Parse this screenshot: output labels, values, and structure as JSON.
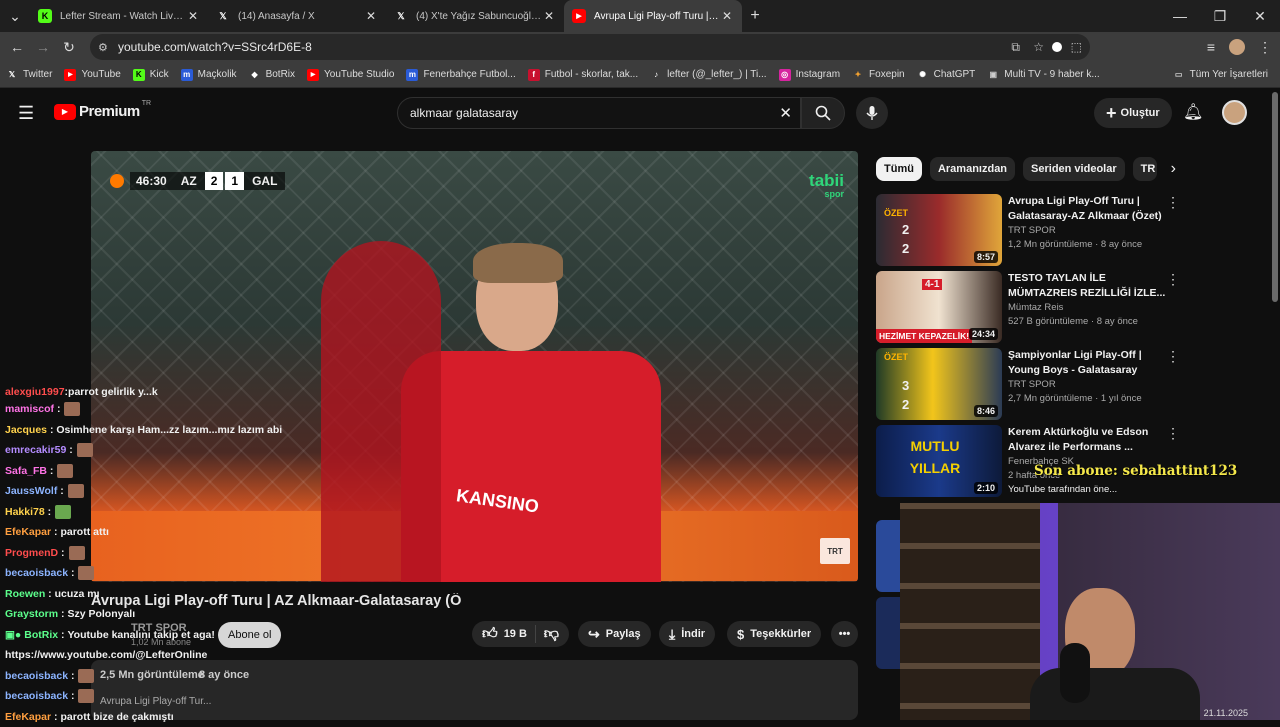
{
  "browser": {
    "tabs": [
      {
        "label": "Lefter Stream - Watch Live on Kick",
        "favicon": "kick-icon",
        "color": "#53fc18"
      },
      {
        "label": "(14) Anasayfa / X",
        "favicon": "x-icon",
        "color": "#000000"
      },
      {
        "label": "(4) X'te Yağız Sabuncuoğlu: \"Öz...",
        "favicon": "x-icon",
        "color": "#000000"
      },
      {
        "label": "Avrupa Ligi Play-off Turu | AZ A...",
        "favicon": "youtube-icon",
        "color": "#ff0000"
      }
    ],
    "url": "youtube.com/watch?v=SSrc4rD6E-8",
    "bookmarks": [
      {
        "label": "Twitter",
        "icon": "x-icon"
      },
      {
        "label": "YouTube",
        "icon": "youtube-icon"
      },
      {
        "label": "Kick",
        "icon": "kick-icon"
      },
      {
        "label": "Maçkolik",
        "icon": "mackolik-icon"
      },
      {
        "label": "BotRix",
        "icon": "botrix-icon"
      },
      {
        "label": "YouTube Studio",
        "icon": "youtube-icon"
      },
      {
        "label": "Fenerbahçe Futbol...",
        "icon": "m-icon"
      },
      {
        "label": "Futbol - skorlar, tak...",
        "icon": "flashscore-icon"
      },
      {
        "label": "lefter (@_lefter_) | Ti...",
        "icon": "tiktok-icon"
      },
      {
        "label": "Instagram",
        "icon": "instagram-icon"
      },
      {
        "label": "Foxepin",
        "icon": "foxepin-icon"
      },
      {
        "label": "ChatGPT",
        "icon": "chatgpt-icon"
      },
      {
        "label": "Multi TV - 9 haber k...",
        "icon": "tv-icon"
      }
    ],
    "all_bookmarks": "Tüm Yer İşaretleri"
  },
  "youtube": {
    "logo": "Premium",
    "region": "TR",
    "search_value": "alkmaar galatasaray",
    "create_label": "Oluştur"
  },
  "player": {
    "scorebug": {
      "time": "46:30",
      "home": "AZ",
      "home_score": "2",
      "away_score": "1",
      "away": "GAL"
    },
    "channel_logo": "tabii",
    "channel_logo_sub": "spor",
    "watermark": "TRT SPOR",
    "jersey_text": "KANSINO"
  },
  "video": {
    "title": "Avrupa Ligi Play-off Turu | AZ Alkmaar-Galatasaray (Ö",
    "channel": "TRT SPOR",
    "subscribers": "1,02 Mn abone",
    "subscribe_label": "Abone ol",
    "likes": "19 B",
    "share_label": "Paylaş",
    "download_label": "İndir",
    "thanks_label": "Teşekkürler",
    "views": "2,5 Mn görüntüleme",
    "age": "8 ay önce",
    "desc_snippet": "Avrupa Ligi Play-off Tur..."
  },
  "filters": [
    "Tümü",
    "Aramanızdan",
    "Seriden videolar",
    "TR"
  ],
  "recommendations": [
    {
      "title": "Avrupa Ligi Play-Off Turu | Galatasaray-AZ Alkmaar (Özet)",
      "channel": "TRT SPOR",
      "meta": "1,2 Mn görüntüleme · 8 ay önce",
      "duration": "8:57",
      "badge": "ÖZET",
      "score1": "2",
      "score2": "2"
    },
    {
      "title": "TESTO TAYLAN İLE MÜMTAZREIS REZİLLİĞİ İZLE...",
      "channel": "Mümtaz Reis",
      "meta": "527 B görüntüleme · 8 ay önce",
      "duration": "24:34",
      "badge": "HEZİMET KEPAZELİK!",
      "score1": "4-1",
      "score2": ""
    },
    {
      "title": "Şampiyonlar Ligi Play-Off | Young Boys - Galatasaray (Özet)",
      "channel": "TRT SPOR",
      "meta": "2,7 Mn görüntüleme · 1 yıl önce",
      "duration": "8:46",
      "badge": "ÖZET",
      "score1": "3",
      "score2": "2"
    },
    {
      "title": "Kerem Aktürkoğlu ve Edson Alvarez ile Performans ...",
      "channel": "Fenerbahçe SK",
      "meta": "2 hafta önce",
      "duration": "2:10",
      "badge": "MUTLU YILLAR",
      "score1": "",
      "score2": ""
    }
  ],
  "rec_extra": "YouTube tarafından öne...",
  "overlay": {
    "new_sub": "Son abone: sebahattint123",
    "date": "21.11.2025"
  },
  "chat": [
    {
      "user": "alexgiu1997",
      "msg": "parrot gelirlik y...k",
      "color": "#ff4d4d"
    },
    {
      "user": "mamiscof",
      "msg": "",
      "color": "#ff73e6",
      "emote": true
    },
    {
      "user": "Jacques",
      "msg": "Osimhene karşı Ham...zz lazım...mız lazım abi",
      "color": "#ffd24d"
    },
    {
      "user": "emrecakir59",
      "msg": "",
      "color": "#b48cff",
      "emote": true
    },
    {
      "user": "Safa_FB",
      "msg": "",
      "color": "#ff73e6",
      "emote": true
    },
    {
      "user": "JaussWolf",
      "msg": "",
      "color": "#8cb4ff",
      "emote": true
    },
    {
      "user": "Hakki78",
      "msg": "",
      "color": "#ffd24d",
      "emote": true
    },
    {
      "user": "EfeKapar",
      "msg": "parott attı",
      "color": "#ff9f40",
      "emote": false
    },
    {
      "user": "ProgmenD",
      "msg": "",
      "color": "#ff4d4d",
      "emote": true
    },
    {
      "user": "becaoisback",
      "msg": "",
      "color": "#8cb4ff",
      "emote": true
    },
    {
      "user": "Roewen",
      "msg": "ucuza mı",
      "color": "#5cff8c"
    },
    {
      "user": "Graystorm",
      "msg": "Szy Polonyalı",
      "color": "#5cff8c"
    },
    {
      "user": "BotRix",
      "msg": "Youtube kanalını takip et aga!",
      "color": "#5cff8c"
    },
    {
      "user": "",
      "msg": "https://www.youtube.com/@LefterOnline",
      "color": "#ffffff"
    },
    {
      "user": "becaoisback",
      "msg": "",
      "color": "#8cb4ff",
      "emote": true
    },
    {
      "user": "becaoisback",
      "msg": "",
      "color": "#8cb4ff",
      "emote": true
    },
    {
      "user": "EfeKapar",
      "msg": "parott bize de çakmıştı",
      "color": "#ff9f40"
    }
  ]
}
